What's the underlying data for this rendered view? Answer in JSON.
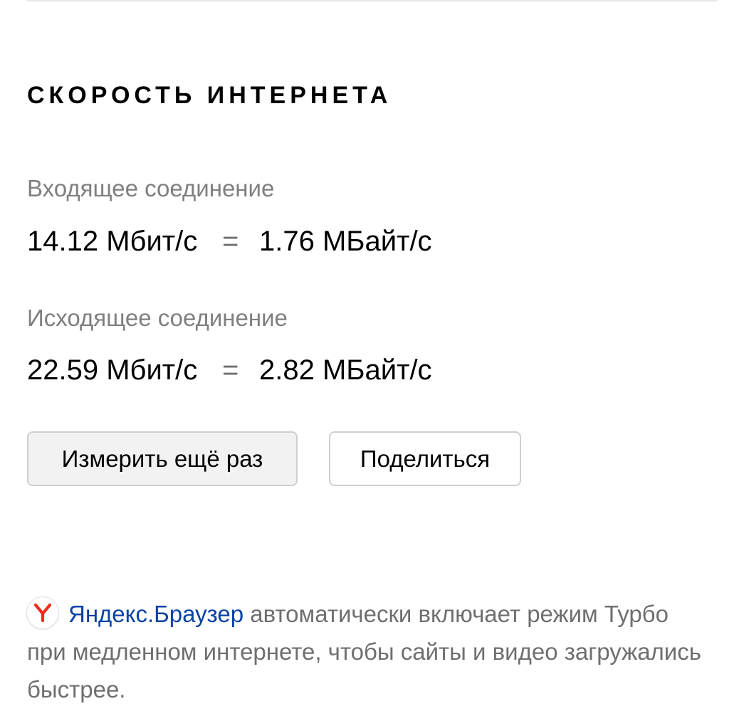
{
  "title": "СКОРОСТЬ ИНТЕРНЕТА",
  "incoming": {
    "label": "Входящее соединение",
    "mbit": "14.12 Мбит/с",
    "equals": "=",
    "mbyte": "1.76 МБайт/с"
  },
  "outgoing": {
    "label": "Исходящее соединение",
    "mbit": "22.59 Мбит/с",
    "equals": "=",
    "mbyte": "2.82 МБайт/с"
  },
  "buttons": {
    "retry": "Измерить ещё раз",
    "share": "Поделиться"
  },
  "promo": {
    "logo_icon": "yandex-browser-logo-icon",
    "link_text": "Яндекс.Браузер",
    "text": " автоматически включает режим Турбо при медленном интернете, чтобы сайты и видео загружались быстрее."
  },
  "colors": {
    "link": "#0b43a5",
    "logo_red": "#f22a1f",
    "muted_text": "#7f7f7f",
    "button_border": "#cfcfcf"
  }
}
